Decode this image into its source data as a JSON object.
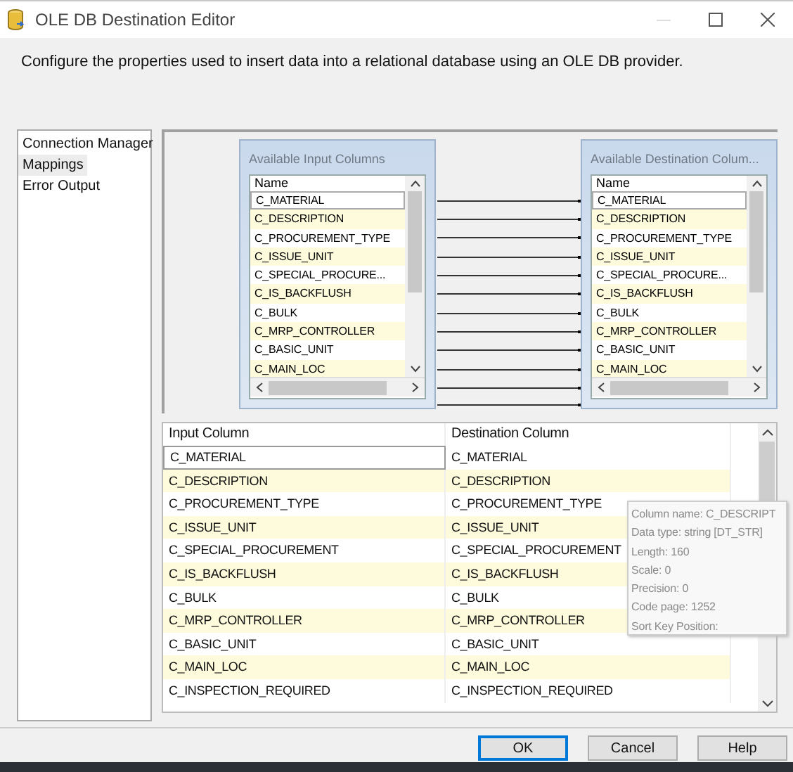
{
  "window": {
    "title": "OLE DB Destination Editor"
  },
  "description": "Configure the properties used to insert data into a relational database using an OLE DB provider.",
  "nav": [
    {
      "label": "Connection Manager",
      "selected": false
    },
    {
      "label": "Mappings",
      "selected": true
    },
    {
      "label": "Error Output",
      "selected": false
    }
  ],
  "input_columns": {
    "title": "Available Input Columns",
    "header": "Name",
    "rows": [
      {
        "name": "C_MATERIAL",
        "selected": true
      },
      {
        "name": "C_DESCRIPTION",
        "selected": false
      },
      {
        "name": "C_PROCUREMENT_TYPE",
        "selected": false
      },
      {
        "name": "C_ISSUE_UNIT",
        "selected": false
      },
      {
        "name": "C_SPECIAL_PROCURE...",
        "selected": false
      },
      {
        "name": "C_IS_BACKFLUSH",
        "selected": false
      },
      {
        "name": "C_BULK",
        "selected": false
      },
      {
        "name": "C_MRP_CONTROLLER",
        "selected": false
      },
      {
        "name": "C_BASIC_UNIT",
        "selected": false
      },
      {
        "name": "C_MAIN_LOC",
        "selected": false
      }
    ]
  },
  "destination_columns": {
    "title": "Available Destination Colum...",
    "header": "Name",
    "rows": [
      {
        "name": "C_MATERIAL",
        "selected": true
      },
      {
        "name": "C_DESCRIPTION",
        "selected": false
      },
      {
        "name": "C_PROCUREMENT_TYPE",
        "selected": false
      },
      {
        "name": "C_ISSUE_UNIT",
        "selected": false
      },
      {
        "name": "C_SPECIAL_PROCURE...",
        "selected": false
      },
      {
        "name": "C_IS_BACKFLUSH",
        "selected": false
      },
      {
        "name": "C_BULK",
        "selected": false
      },
      {
        "name": "C_MRP_CONTROLLER",
        "selected": false
      },
      {
        "name": "C_BASIC_UNIT",
        "selected": false
      },
      {
        "name": "C_MAIN_LOC",
        "selected": false
      }
    ]
  },
  "mapping_table": {
    "columns": [
      "Input Column",
      "Destination Column"
    ],
    "rows": [
      {
        "input": "C_MATERIAL",
        "destination": "C_MATERIAL",
        "selected": true
      },
      {
        "input": "C_DESCRIPTION",
        "destination": "C_DESCRIPTION",
        "selected": false
      },
      {
        "input": "C_PROCUREMENT_TYPE",
        "destination": "C_PROCUREMENT_TYPE",
        "selected": false
      },
      {
        "input": "C_ISSUE_UNIT",
        "destination": "C_ISSUE_UNIT",
        "selected": false
      },
      {
        "input": "C_SPECIAL_PROCUREMENT",
        "destination": "C_SPECIAL_PROCUREMENT",
        "selected": false
      },
      {
        "input": "C_IS_BACKFLUSH",
        "destination": "C_IS_BACKFLUSH",
        "selected": false
      },
      {
        "input": "C_BULK",
        "destination": "C_BULK",
        "selected": false
      },
      {
        "input": "C_MRP_CONTROLLER",
        "destination": "C_MRP_CONTROLLER",
        "selected": false
      },
      {
        "input": "C_BASIC_UNIT",
        "destination": "C_BASIC_UNIT",
        "selected": false
      },
      {
        "input": "C_MAIN_LOC",
        "destination": "C_MAIN_LOC",
        "selected": false
      },
      {
        "input": "C_INSPECTION_REQUIRED",
        "destination": "C_INSPECTION_REQUIRED",
        "selected": false
      }
    ]
  },
  "tooltip": {
    "lines": [
      "Column name: C_DESCRIPT",
      "Data type: string [DT_STR]",
      "Length: 160",
      "Scale: 0",
      "Precision: 0",
      "Code page: 1252",
      "Sort Key Position:"
    ]
  },
  "buttons": [
    {
      "label": "OK",
      "focused": true
    },
    {
      "label": "Cancel",
      "focused": false
    },
    {
      "label": "Help",
      "focused": false
    }
  ]
}
